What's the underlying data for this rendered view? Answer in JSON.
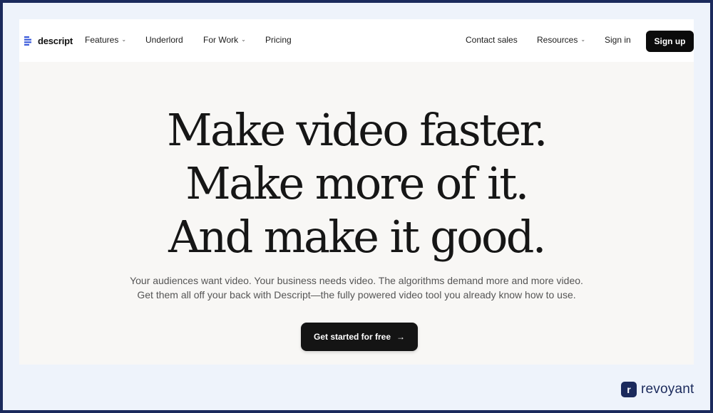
{
  "brand": {
    "name": "descript",
    "color": "#3b5bdb"
  },
  "nav": {
    "left": [
      {
        "label": "Features",
        "dropdown": true
      },
      {
        "label": "Underlord",
        "dropdown": false
      },
      {
        "label": "For Work",
        "dropdown": true
      },
      {
        "label": "Pricing",
        "dropdown": false
      }
    ],
    "right": [
      {
        "label": "Contact sales",
        "dropdown": false
      },
      {
        "label": "Resources",
        "dropdown": true
      },
      {
        "label": "Sign in",
        "dropdown": false
      }
    ],
    "signup_label": "Sign up",
    "dropdown_icon": "chevron-down-icon"
  },
  "hero": {
    "title_lines": [
      "Make video faster.",
      "Make more of it.",
      "And make it good."
    ],
    "subtitle_lines": [
      "Your audiences want video. Your business needs video. The algorithms demand more and more video.",
      "Get them all off your back with Descript—the fully powered video tool you already know how to use."
    ],
    "cta_label": "Get started for free",
    "cta_icon": "arrow-right-icon"
  },
  "watermark": {
    "mark": "r",
    "text": "revoyant",
    "color": "#1b2a5c"
  },
  "colors": {
    "page_bg": "#f8f7f5",
    "nav_bg": "#ffffff",
    "frame": "#1b2a5c",
    "button": "#0b0b0b"
  }
}
